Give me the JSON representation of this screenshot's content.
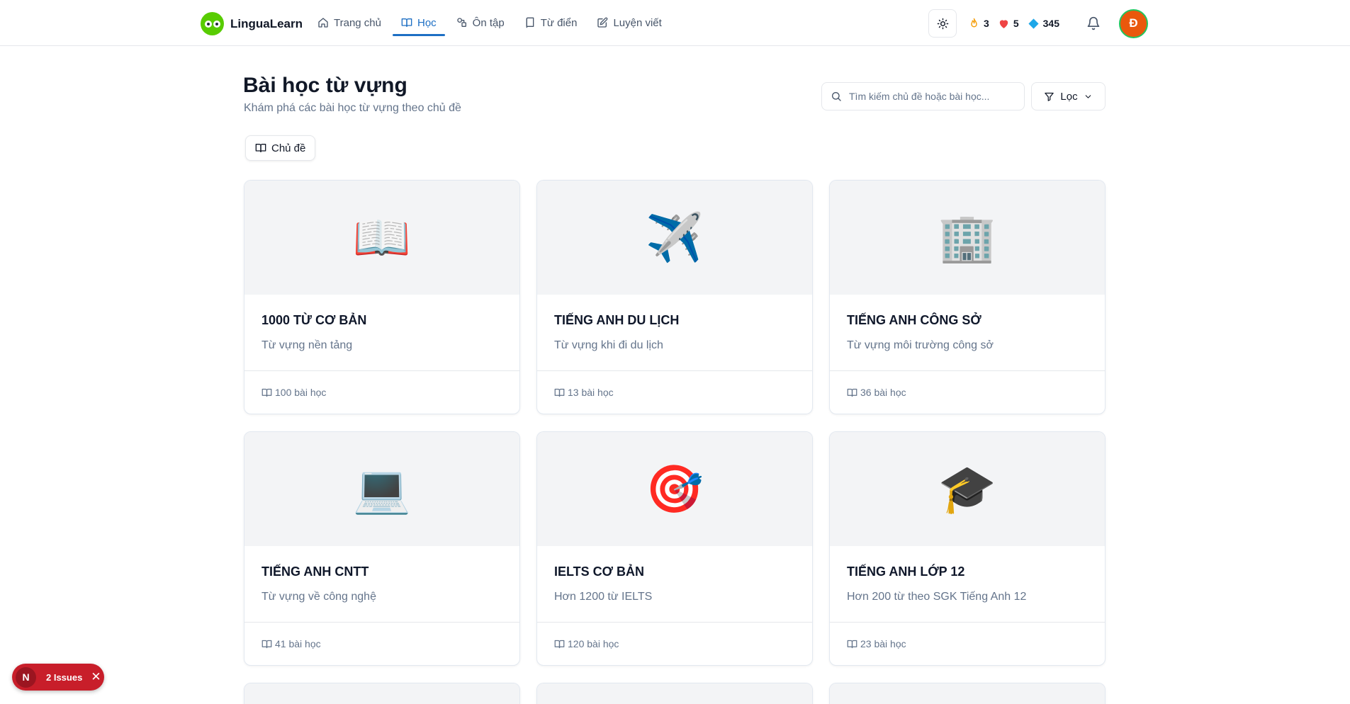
{
  "brand": {
    "name": "LinguaLearn"
  },
  "nav": [
    {
      "label": "Trang chủ",
      "icon": "home-icon"
    },
    {
      "label": "Học",
      "icon": "book-icon",
      "active": true
    },
    {
      "label": "Ôn tập",
      "icon": "review-icon"
    },
    {
      "label": "Từ điển",
      "icon": "dictionary-icon"
    },
    {
      "label": "Luyện viết",
      "icon": "pencil-icon"
    }
  ],
  "stats": {
    "streak": "3",
    "hearts": "5",
    "gems": "345"
  },
  "user": {
    "avatar_letter": "Đ"
  },
  "header": {
    "title": "Bài học từ vựng",
    "subtitle": "Khám phá các bài học từ vựng theo chủ đề",
    "search_placeholder": "Tìm kiếm chủ đề hoặc bài học...",
    "filter_label": "Lọc"
  },
  "tabs": {
    "topic_label": "Chủ đề"
  },
  "cards": [
    {
      "emoji": "📖",
      "title": "1000 TỪ CƠ BẢN",
      "desc": "Từ vựng nền tảng",
      "lessons": "100 bài học"
    },
    {
      "emoji": "✈️",
      "title": "TIẾNG ANH DU LỊCH",
      "desc": "Từ vựng khi đi du lịch",
      "lessons": "13 bài học"
    },
    {
      "emoji": "🏢",
      "title": "TIẾNG ANH CÔNG SỞ",
      "desc": "Từ vựng môi trường công sở",
      "lessons": "36 bài học"
    },
    {
      "emoji": "💻",
      "title": "TIẾNG ANH CNTT",
      "desc": "Từ vựng về công nghệ",
      "lessons": "41 bài học"
    },
    {
      "emoji": "🎯",
      "title": "IELTS CƠ BẢN",
      "desc": "Hơn 1200 từ IELTS",
      "lessons": "120 bài học"
    },
    {
      "emoji": "🎓",
      "title": "TIẾNG ANH LỚP 12",
      "desc": "Hơn 200 từ theo SGK Tiếng Anh 12",
      "lessons": "23 bài học"
    }
  ],
  "issues": {
    "logo": "N",
    "label": "2 Issues",
    "close": "✕"
  },
  "colors": {
    "accent": "#1d6fc4",
    "brand_green": "#58cc02",
    "issues_red": "#c81e2a",
    "avatar": "#ea580c"
  }
}
